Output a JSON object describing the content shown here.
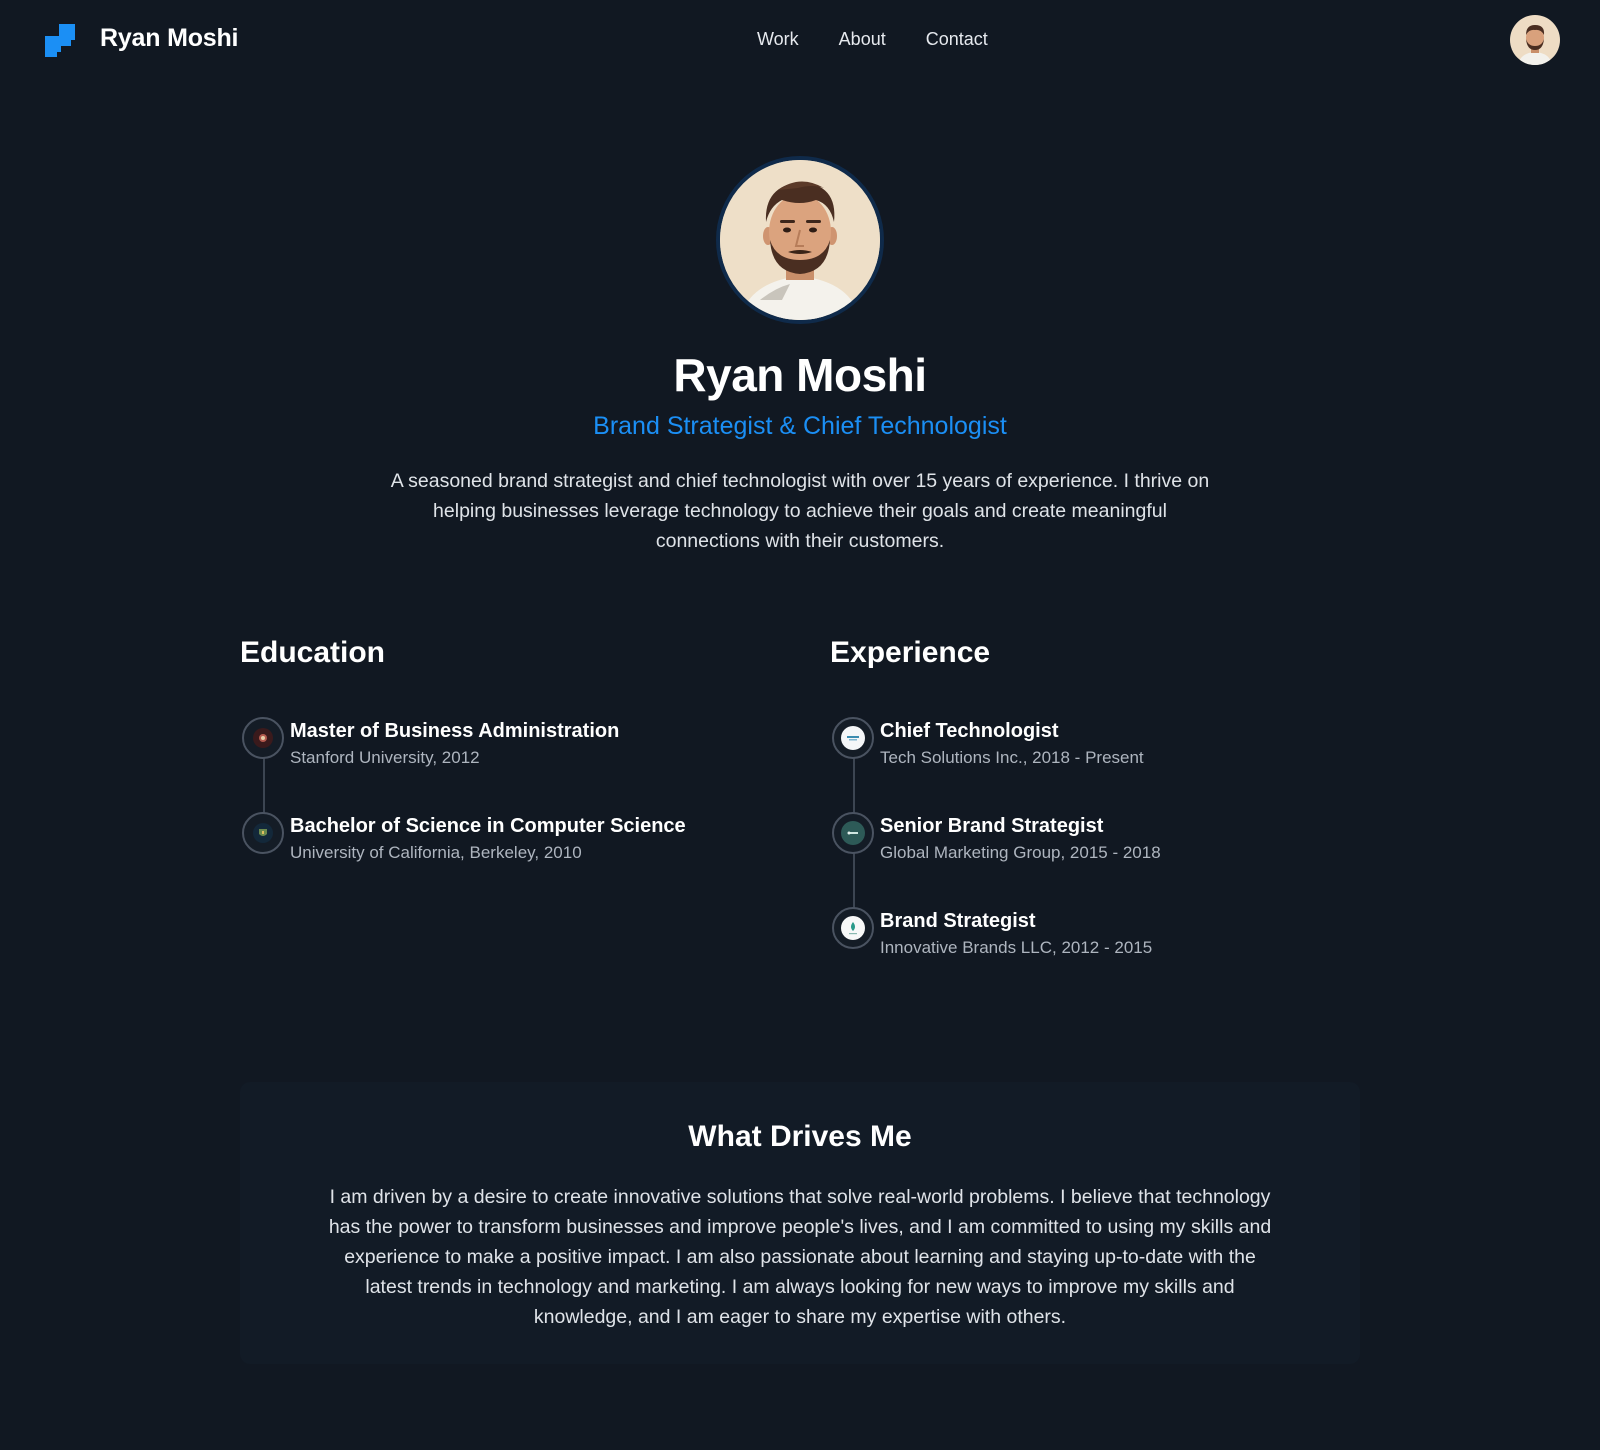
{
  "header": {
    "brand": "Ryan Moshi",
    "nav": [
      "Work",
      "About",
      "Contact"
    ],
    "logo_color": "#1b8ff5"
  },
  "hero": {
    "name": "Ryan Moshi",
    "title": "Brand Strategist & Chief Technologist",
    "description": "A seasoned brand strategist and chief technologist with over 15 years of experience. I thrive on helping businesses leverage technology to achieve their goals and create meaningful connections with their customers."
  },
  "education": {
    "heading": "Education",
    "items": [
      {
        "title": "Master of Business Administration",
        "subtitle": "Stanford University, 2012",
        "icon": "stanford-seal-icon"
      },
      {
        "title": "Bachelor of Science in Computer Science",
        "subtitle": "University of California, Berkeley, 2010",
        "icon": "berkeley-seal-icon"
      }
    ]
  },
  "experience": {
    "heading": "Experience",
    "items": [
      {
        "title": "Chief Technologist",
        "subtitle": "Tech Solutions Inc., 2018 - Present",
        "icon": "tech-solutions-logo-icon"
      },
      {
        "title": "Senior Brand Strategist",
        "subtitle": "Global Marketing Group, 2015 - 2018",
        "icon": "global-marketing-logo-icon"
      },
      {
        "title": "Brand Strategist",
        "subtitle": "Innovative Brands LLC, 2012 - 2015",
        "icon": "innovative-brands-logo-icon"
      }
    ]
  },
  "drives": {
    "heading": "What Drives Me",
    "text": "I am driven by a desire to create innovative solutions that solve real-world problems. I believe that technology has the power to transform businesses and improve people's lives, and I am committed to using my skills and experience to make a positive impact. I am also passionate about learning and staying up-to-date with the latest trends in technology and marketing. I am always looking for new ways to improve my skills and knowledge, and I am eager to share my expertise with others."
  },
  "colors": {
    "background": "#111822",
    "accent": "#1b8ff5",
    "muted_text": "#aeb5bf"
  }
}
